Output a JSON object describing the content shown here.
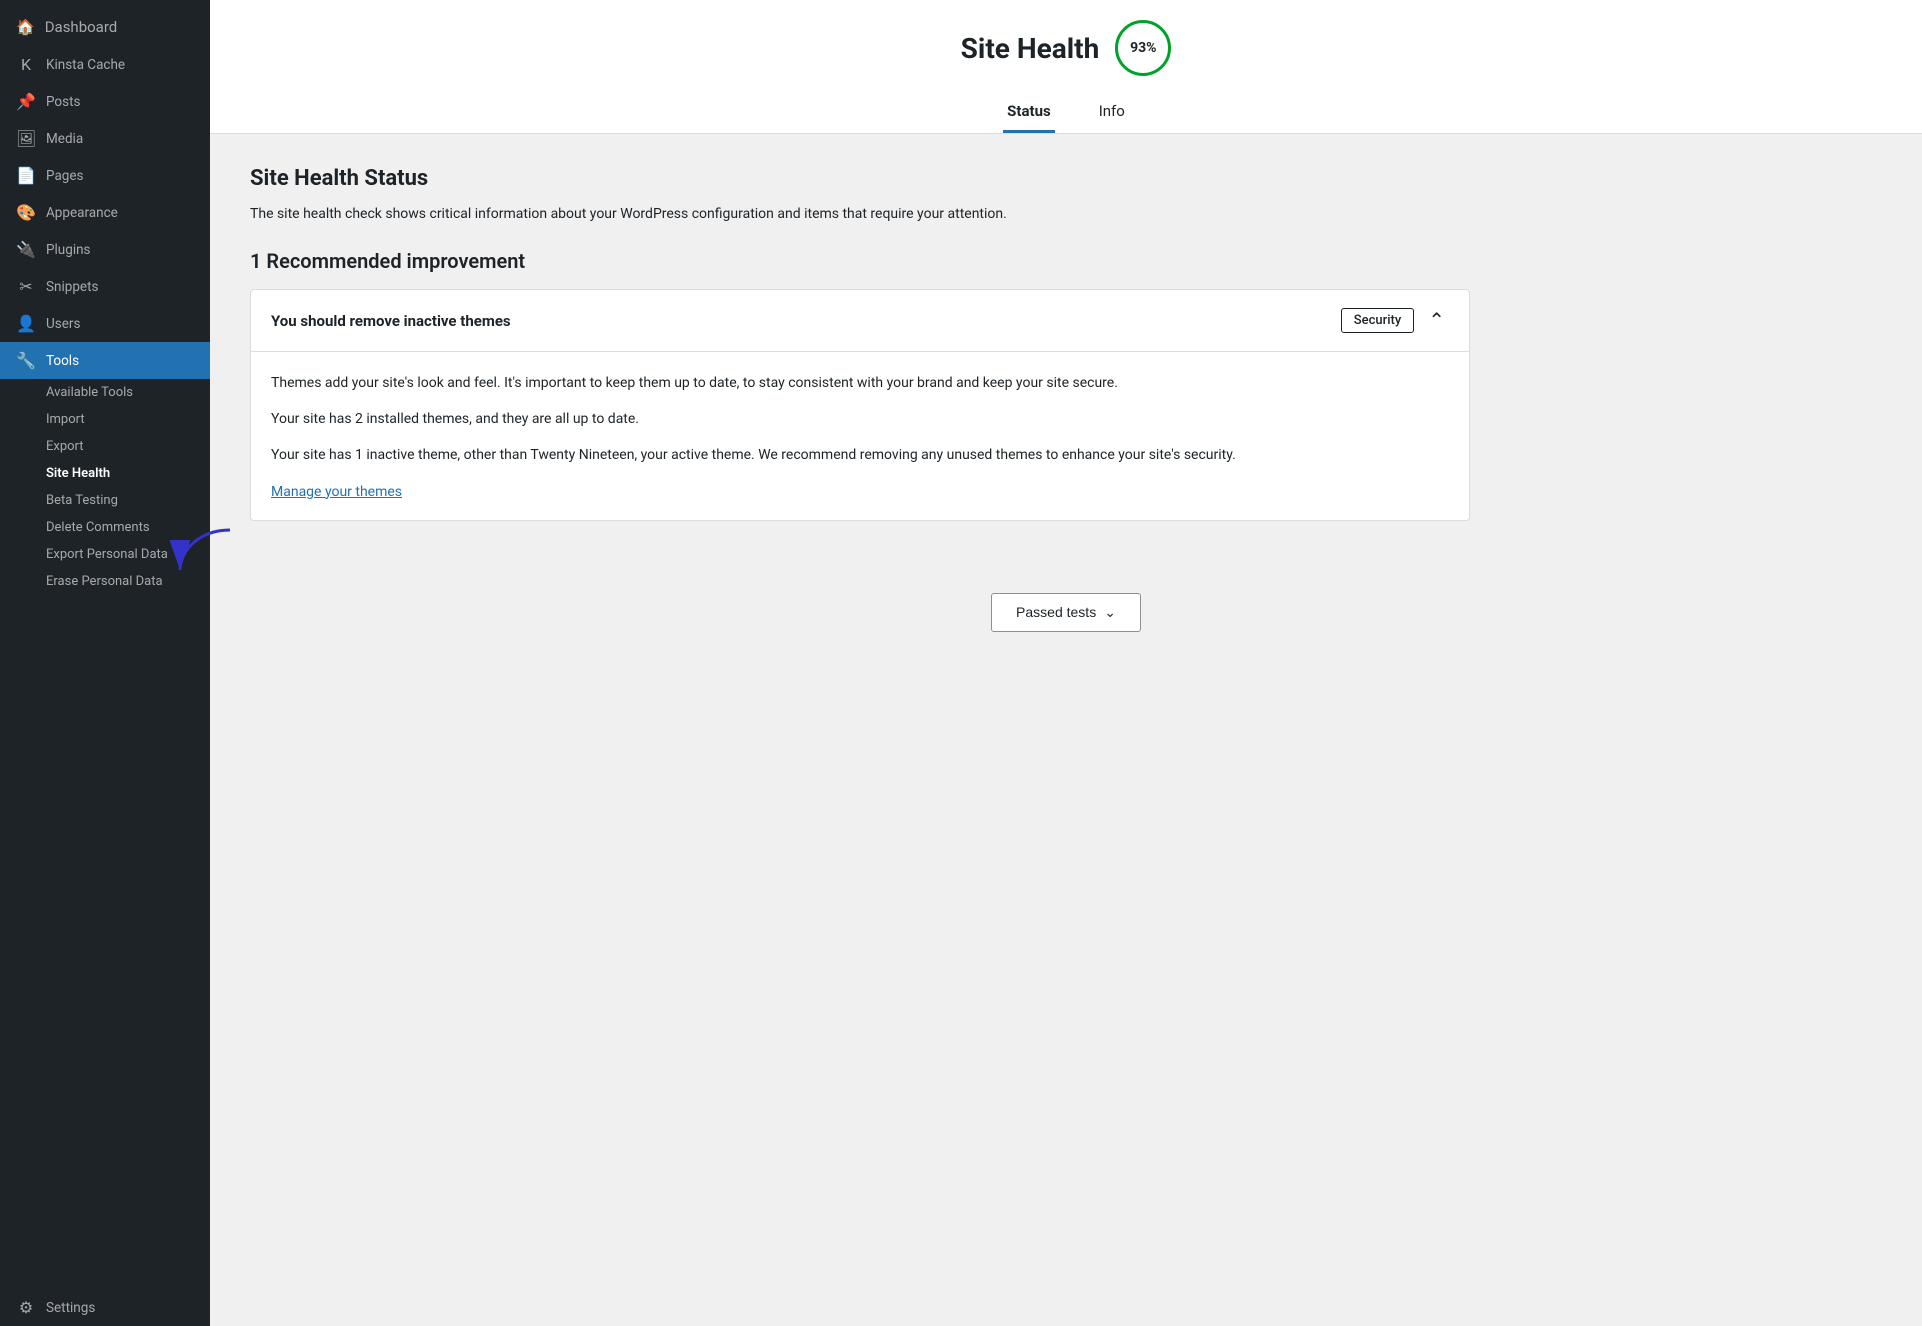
{
  "sidebar": {
    "items": [
      {
        "id": "dashboard",
        "label": "Dashboard",
        "icon": "🏠"
      },
      {
        "id": "kinsta-cache",
        "label": "Kinsta Cache",
        "icon": "K"
      },
      {
        "id": "posts",
        "label": "Posts",
        "icon": "📌"
      },
      {
        "id": "media",
        "label": "Media",
        "icon": "🖼"
      },
      {
        "id": "pages",
        "label": "Pages",
        "icon": "📄"
      },
      {
        "id": "appearance",
        "label": "Appearance",
        "icon": "🎨"
      },
      {
        "id": "plugins",
        "label": "Plugins",
        "icon": "🔌"
      },
      {
        "id": "snippets",
        "label": "Snippets",
        "icon": "✂"
      },
      {
        "id": "users",
        "label": "Users",
        "icon": "👤"
      },
      {
        "id": "tools",
        "label": "Tools",
        "icon": "🔧",
        "active": true
      }
    ],
    "tools_submenu": [
      {
        "id": "available-tools",
        "label": "Available Tools"
      },
      {
        "id": "import",
        "label": "Import"
      },
      {
        "id": "export",
        "label": "Export"
      },
      {
        "id": "site-health",
        "label": "Site Health",
        "active": true
      },
      {
        "id": "beta-testing",
        "label": "Beta Testing"
      },
      {
        "id": "delete-comments",
        "label": "Delete Comments"
      },
      {
        "id": "export-personal-data",
        "label": "Export Personal Data"
      },
      {
        "id": "erase-personal-data",
        "label": "Erase Personal Data"
      }
    ],
    "settings_item": {
      "id": "settings",
      "label": "Settings",
      "icon": "⚙"
    }
  },
  "header": {
    "title": "Site Health",
    "score": "93%",
    "tabs": [
      {
        "id": "status",
        "label": "Status",
        "active": true
      },
      {
        "id": "info",
        "label": "Info",
        "active": false
      }
    ]
  },
  "main": {
    "section_title": "Site Health Status",
    "section_description": "The site health check shows critical information about your WordPress configuration and items that require your attention.",
    "recommendation_heading": "1 Recommended improvement",
    "card": {
      "title": "You should remove inactive themes",
      "badge": "Security",
      "body_paragraphs": [
        "Themes add your site's look and feel. It's important to keep them up to date, to stay consistent with your brand and keep your site secure.",
        "Your site has 2 installed themes, and they are all up to date.",
        "Your site has 1 inactive theme, other than Twenty Nineteen, your active theme. We recommend removing any unused themes to enhance your site's security."
      ],
      "link_text": "Manage your themes"
    },
    "passed_tests_button": "Passed tests"
  }
}
